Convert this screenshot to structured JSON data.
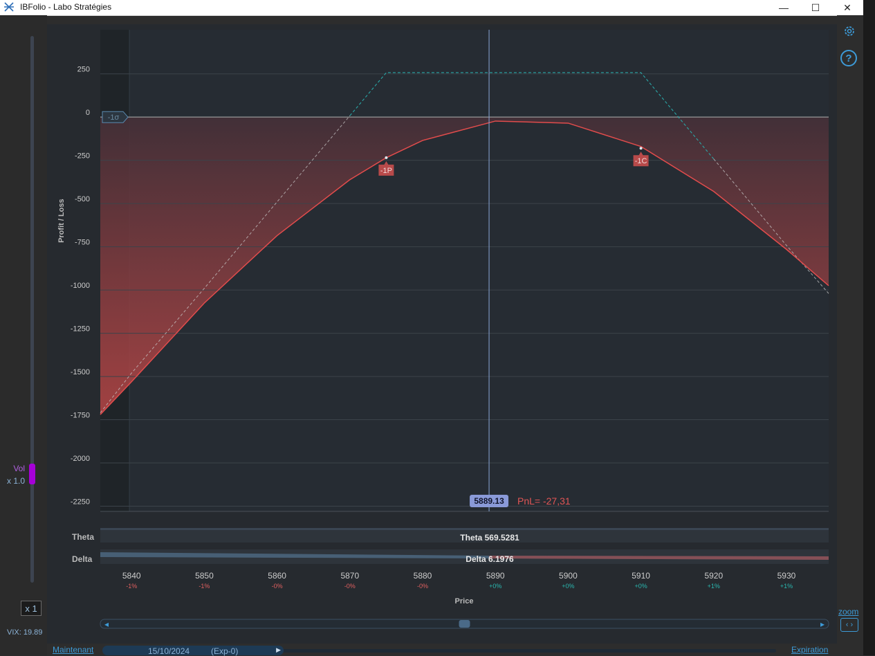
{
  "window": {
    "title": "IBFolio - Labo Stratégies",
    "minimize": "—",
    "maximize": "☐",
    "close": "✕"
  },
  "left_panel": {
    "vol_label": "Vol",
    "vol_multiplier": "x 1.0",
    "vol_level": 0.19,
    "x1_button": "x 1",
    "vix": "VIX: 19.89"
  },
  "right_tools": {
    "settings_icon": "gear-icon",
    "help_label": "?",
    "zoom_label": "zoom",
    "zoom_button": "‹ ›"
  },
  "bottom": {
    "now_label": "Maintenant",
    "date": "15/10/2024",
    "expiry_tag": "(Exp-0)",
    "expiration_label": "Expiration"
  },
  "chart_data": {
    "type": "line",
    "xlabel": "Price",
    "ylabel": "Profit / Loss",
    "xlim": [
      5835.7,
      5935.8
    ],
    "ylim": [
      -2280,
      505
    ],
    "y_ticks": [
      250,
      0,
      -250,
      -500,
      -750,
      -1000,
      -1250,
      -1500,
      -1750,
      -2000,
      -2250
    ],
    "x_ticks": [
      5840,
      5850,
      5860,
      5870,
      5880,
      5890,
      5900,
      5910,
      5920,
      5930
    ],
    "x_pct_labels": [
      "-1%",
      "-1%",
      "-0%",
      "-0%",
      "-0%",
      "+0%",
      "+0%",
      "+0%",
      "+1%",
      "+1%"
    ],
    "sigma_label": "-1σ",
    "sigma_price": 5839.7,
    "current_price": 5889.13,
    "current_price_label": "5889.13",
    "pnl_label": "PnL= -27,31",
    "colors": {
      "current": "#e24c4c",
      "expiration": "#2aa8a8",
      "cursor": "#8aa6d8",
      "badge": "#8a9ad8",
      "loss_fill": "#b84646"
    },
    "series": [
      {
        "x": [
          5835.7,
          5840,
          5850,
          5860,
          5870,
          5875,
          5880,
          5890,
          5900,
          5910,
          5920,
          5930,
          5935.8
        ],
        "y": [
          -1720,
          -1530,
          -1075,
          -685,
          -362,
          -235,
          -135,
          -23,
          -35,
          -170,
          -430,
          -765,
          -975
        ]
      },
      {
        "x": [
          5835.7,
          5840,
          5850,
          5860,
          5870,
          5875,
          5910,
          5920,
          5930,
          5935.8
        ],
        "y": [
          -1710,
          -1480,
          -990,
          -490,
          8,
          257,
          257,
          -242,
          -742,
          -1020
        ]
      }
    ],
    "markers": [
      {
        "label": "-1P",
        "x": 5875,
        "y": -235
      },
      {
        "label": "-1C",
        "x": 5910,
        "y": -180
      }
    ],
    "greeks": [
      {
        "name": "Theta",
        "value": "Theta 569.5281"
      },
      {
        "name": "Delta",
        "value": "Delta 6.1976"
      }
    ]
  }
}
